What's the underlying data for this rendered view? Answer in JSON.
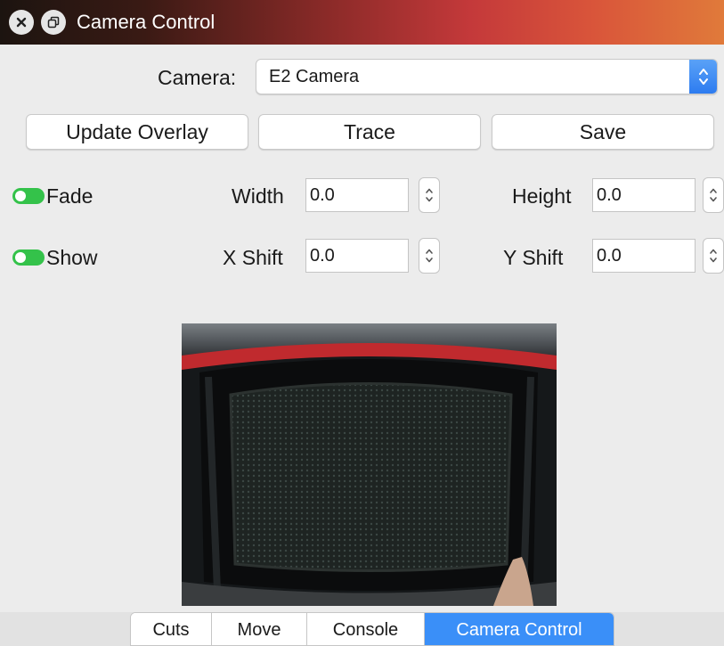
{
  "window": {
    "title": "Camera Control"
  },
  "camera_select": {
    "label": "Camera:",
    "value": "E2 Camera"
  },
  "buttons": {
    "update_overlay": "Update Overlay",
    "trace": "Trace",
    "save": "Save"
  },
  "toggles": {
    "fade": {
      "label": "Fade",
      "on": true
    },
    "show": {
      "label": "Show",
      "on": true
    }
  },
  "fields": {
    "width": {
      "label": "Width",
      "value": "0.0"
    },
    "height": {
      "label": "Height",
      "value": "0.0"
    },
    "x_shift": {
      "label": "X Shift",
      "value": "0.0"
    },
    "y_shift": {
      "label": "Y Shift",
      "value": "0.0"
    }
  },
  "tabs": [
    "Cuts",
    "Move",
    "Console",
    "Camera Control"
  ],
  "active_tab": "Camera Control",
  "colors": {
    "accent": "#3a8ff8",
    "toggle_on": "#34c24a"
  }
}
